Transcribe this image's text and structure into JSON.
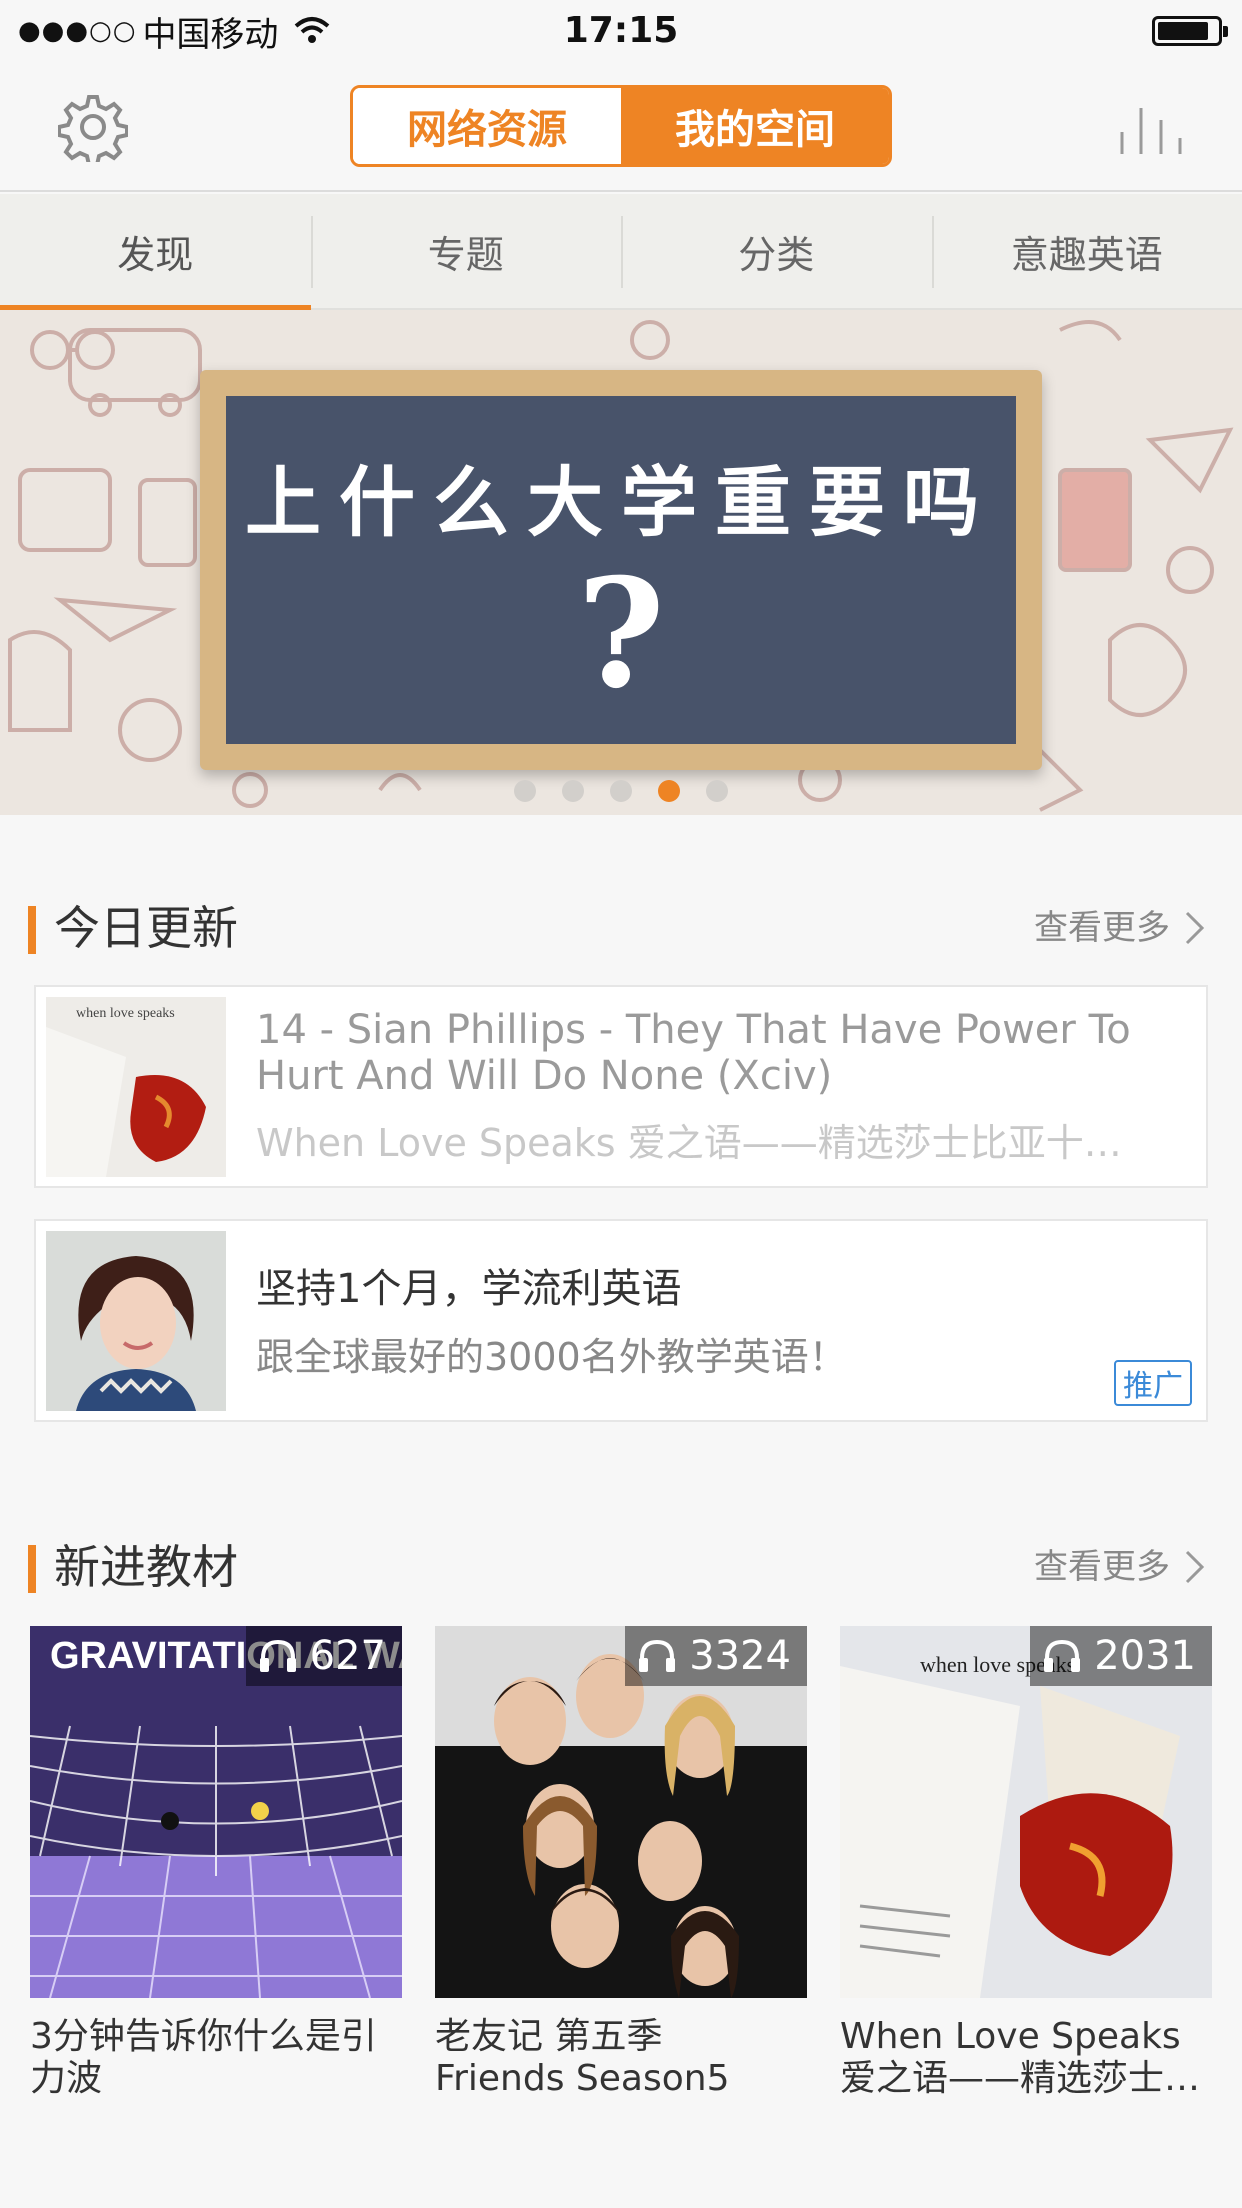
{
  "status_bar": {
    "signal": "●●●○○",
    "carrier": "中国移动",
    "time": "17:15"
  },
  "header": {
    "segment_left": "网络资源",
    "segment_right": "我的空间",
    "accent_color": "#ee8424"
  },
  "tabs": [
    {
      "label": "发现",
      "active": true
    },
    {
      "label": "专题",
      "active": false
    },
    {
      "label": "分类",
      "active": false
    },
    {
      "label": "意趣英语",
      "active": false
    }
  ],
  "banner": {
    "headline": "上什么大学重要吗",
    "mark": "?",
    "pages": 5,
    "active_page": 4
  },
  "today_updates": {
    "title": "今日更新",
    "more": "查看更多",
    "items": [
      {
        "title": "14 - Sian Phillips - They That Have Power To Hurt And Will Do None (Xciv)",
        "subtitle": "When Love Speaks 爱之语——精选莎士比亚十…",
        "thumb_caption": "when love speaks"
      },
      {
        "title": "坚持1个月，学流利英语",
        "subtitle": "跟全球最好的3000名外教学英语！",
        "badge": "推广"
      }
    ]
  },
  "new_materials": {
    "title": "新进教材",
    "more": "查看更多",
    "items": [
      {
        "plays": "627",
        "cover_text": "GRAVITATIONAL WAVES",
        "name": "3分钟告诉你什么是引力波"
      },
      {
        "plays": "3324",
        "name": " 老友记 第五季\nFriends Season5"
      },
      {
        "plays": "2031",
        "cover_text": "when love speaks",
        "name": "When Love Speaks\n爱之语——精选莎士…"
      }
    ]
  }
}
